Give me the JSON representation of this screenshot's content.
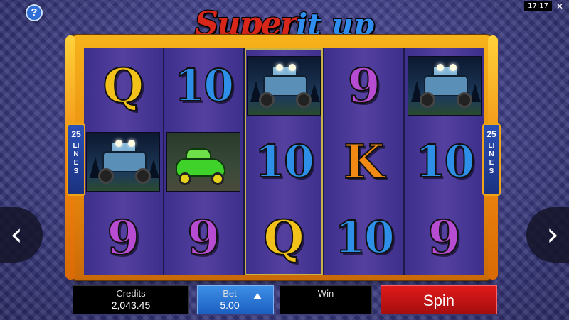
{
  "clock": "17:17",
  "help_label": "?",
  "logo": {
    "part1": "Super",
    "part2": "it up"
  },
  "lines": {
    "count": "25",
    "word": "LINES"
  },
  "reels": [
    [
      "Q",
      "truck",
      "9"
    ],
    [
      "10",
      "car",
      "9"
    ],
    [
      "truck",
      "10",
      "Q"
    ],
    [
      "9",
      "K",
      "10"
    ],
    [
      "truck",
      "10",
      "9"
    ]
  ],
  "panel": {
    "credits_label": "Credits",
    "credits_value": "2,043.45",
    "bet_label": "Bet",
    "bet_value": "5.00",
    "win_label": "Win",
    "win_value": "",
    "spin_label": "Spin"
  },
  "nav": {
    "prev": "‹",
    "next": "›"
  },
  "colors": {
    "accent_gold": "#f6b21b",
    "spin_red": "#e01a1a",
    "bet_blue": "#3d8fe6",
    "reel_purple": "#54409f"
  }
}
